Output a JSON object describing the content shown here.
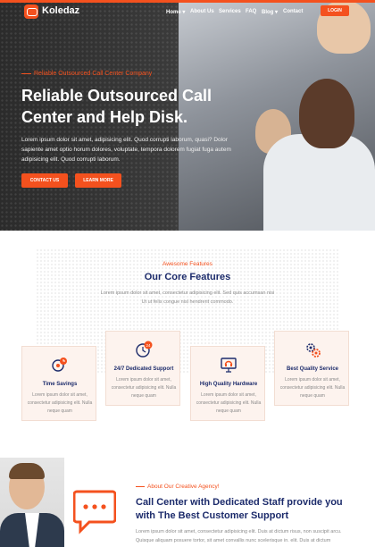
{
  "colors": {
    "accent": "#f4511e",
    "heading": "#1c2b6b",
    "card_bg": "#fdf3ee"
  },
  "nav": {
    "logo_text": "Koledaz",
    "items": [
      "Home ▾",
      "About Us",
      "Services",
      "FAQ",
      "Blog ▾",
      "Contact"
    ],
    "login_label": "LOGIN"
  },
  "hero": {
    "subtitle": "Reliable Outsourced Call Center Company",
    "title": "Reliable Outsourced Call Center and Help Disk.",
    "text": "Lorem ipsum dolor sit amet, adipisicing elit. Quod corrupti laborum, quasi? Dolor sapiente amet optio horum dolores, voluptate, tempora dolorem fugiat fuga autem adipisicing elit. Quod corrupti laborum.",
    "contact_label": "CONTACT US",
    "learn_label": "LEARN MORE"
  },
  "features": {
    "tag": "Awesome Features",
    "title": "Our Core Features",
    "text": "Lorem ipsum dolor sit amet, consectetur adipisicing elit. Sed quis accumsan nisi Ut ut felis congue nisl hendrerit commodo.",
    "cards": [
      {
        "icon": "gears-time-icon",
        "title": "Time Savings",
        "text": "Lorem ipsum dolor sit amet, consectetur adipisicing elit. Nulla neque quam"
      },
      {
        "icon": "clock-24-icon",
        "title": "24/7 Dedicated Support",
        "text": "Lorem ipsum dolor sit amet, consectetur adipisicing elit. Nulla neque quam"
      },
      {
        "icon": "headset-monitor-icon",
        "title": "High Quality Hardware",
        "text": "Lorem ipsum dolor sit amet, consectetur adipisicing elit. Nulla neque quam"
      },
      {
        "icon": "gear-service-icon",
        "title": "Best Quality Service",
        "text": "Lorem ipsum dolor sit amet, consectetur adipisicing elit. Nulla neque quam"
      }
    ]
  },
  "about": {
    "tag": "About Our Creative Agency!",
    "title": "Call Center with Dedicated Staff provide you with The Best Customer Support",
    "text": "Lorem ipsum dolor sit amet, consectetur adipisicing elit. Duis at dictum risus, non suscipit arcu. Quisque aliquam posuere tortor, sit amet convallis nunc scelerisque in. elit. Duis at dictum"
  }
}
